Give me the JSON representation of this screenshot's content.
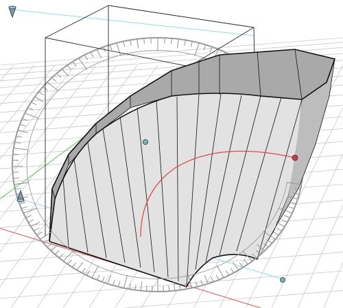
{
  "viewport": {
    "background": "#ffffff",
    "grid_color": "#c8c8c8",
    "x_axis_color": "#e05050",
    "y_axis_color": "#58c858",
    "z_axis_color": "#8ee0e0",
    "bounding_box_color": "#222222",
    "protractor_color": "#9a9a9a",
    "arc_guide_color": "#e04848",
    "handle_color_teal": "#6fb8b0",
    "handle_color_red": "#d03c3c"
  },
  "model": {
    "name": "bent-extruded-solid",
    "segment_count": 16,
    "face_front_color": "#e2e2e2",
    "face_top_color": "#a9a9a9",
    "face_side_color": "#bdbdbd",
    "edge_color": "#111111"
  },
  "gizmos": {
    "protractor": {
      "type": "rotation-protractor",
      "tick_count": 72
    },
    "handles": [
      "center-handle",
      "arc-endpoint-handle",
      "axis-end-handle",
      "origin-handle"
    ],
    "triad_marker": "cone-marker-icon"
  }
}
